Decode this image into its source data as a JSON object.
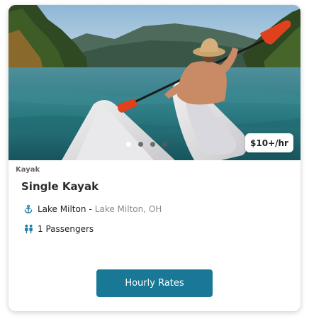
{
  "card": {
    "price": "$10+/hr",
    "carousel": {
      "total": 4,
      "active_index": 0
    },
    "category": "Kayak",
    "title": "Single Kayak",
    "location": {
      "name": "Lake Milton",
      "separator": "-",
      "area": "Lake Milton, OH",
      "icon": "anchor-icon"
    },
    "passengers": {
      "text": "1 Passengers",
      "icon": "people-icon"
    },
    "cta_label": "Hourly Rates"
  },
  "colors": {
    "accent": "#187896",
    "icon_blue": "#1f7fa6",
    "paddle_orange": "#e0401c"
  }
}
